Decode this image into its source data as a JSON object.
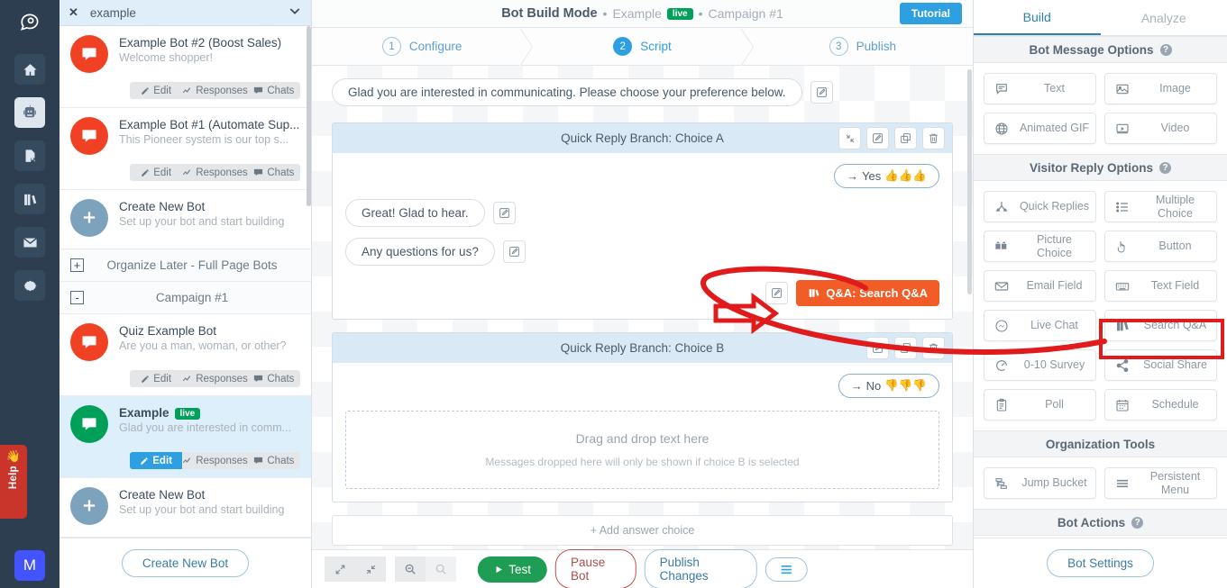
{
  "rail": {
    "logo": "speech-bubble-logo",
    "items": [
      {
        "name": "home",
        "icon": "home-icon",
        "active": false
      },
      {
        "name": "bots",
        "icon": "robot-icon",
        "active": true
      },
      {
        "name": "pages",
        "icon": "page-click-icon",
        "active": false
      },
      {
        "name": "library",
        "icon": "books-icon",
        "active": false
      },
      {
        "name": "email",
        "icon": "envelope-icon",
        "active": false
      },
      {
        "name": "settings",
        "icon": "gear-icon",
        "active": false
      }
    ],
    "help_label": "Help",
    "avatar_initial": "M"
  },
  "sidebar": {
    "search": {
      "value": "example",
      "clear_icon": "close-icon",
      "chevron_icon": "chevron-down-icon"
    },
    "action_labels": {
      "edit": "Edit",
      "responses": "Responses",
      "chats": "Chats"
    },
    "rows": [
      {
        "type": "bot",
        "name": "Example Bot #2 (Boost Sales)",
        "sub": "Welcome shopper!",
        "avatar": "red",
        "selected": false,
        "live": false,
        "edit_active": false
      },
      {
        "type": "bot",
        "name": "Example Bot #1 (Automate Sup...",
        "sub": "This Pioneer system is our top s...",
        "avatar": "red",
        "selected": false,
        "live": false,
        "edit_active": false
      },
      {
        "type": "new",
        "name": "Create New Bot",
        "sub": "Set up your bot and start building",
        "avatar": "blue"
      },
      {
        "type": "group",
        "label": "Organize Later - Full Page Bots",
        "toggle": "+"
      },
      {
        "type": "group",
        "label": "Campaign #1",
        "toggle": "-"
      },
      {
        "type": "bot",
        "name": "Quiz Example Bot",
        "sub": "Are you a man, woman, or other?",
        "avatar": "red",
        "selected": false,
        "live": false,
        "edit_active": false
      },
      {
        "type": "bot",
        "name": "Example",
        "sub": "Glad you are interested in comm...",
        "avatar": "green",
        "selected": true,
        "live": true,
        "live_label": "live",
        "edit_active": true
      },
      {
        "type": "new",
        "name": "Create New Bot",
        "sub": "Set up your bot and start building",
        "avatar": "blue"
      }
    ],
    "footer_button": "Create New Bot"
  },
  "center": {
    "title": {
      "mode": "Bot Build Mode",
      "bot_name": "Example",
      "live_label": "live",
      "campaign": "Campaign #1",
      "separator": "•"
    },
    "tutorial_button": "Tutorial",
    "steps": [
      {
        "num": "1",
        "label": "Configure",
        "active": false
      },
      {
        "num": "2",
        "label": "Script",
        "active": true
      },
      {
        "num": "3",
        "label": "Publish",
        "active": false
      }
    ],
    "intro_message": "Glad you are interested in communicating. Please choose your preference below.",
    "branch_a": {
      "title": "Quick Reply Branch: Choice A",
      "tools": [
        "collapse-icon",
        "edit-icon",
        "duplicate-icon",
        "delete-icon"
      ],
      "reply": {
        "arrow": "→",
        "label": "Yes",
        "emoji": "👍👍👍"
      },
      "messages": [
        "Great! Glad to hear.",
        "Any questions for us?"
      ],
      "qa_button": "Q&A: Search Q&A"
    },
    "branch_b": {
      "title": "Quick Reply Branch: Choice B",
      "tools": [
        "edit-icon",
        "duplicate-icon",
        "delete-icon"
      ],
      "reply": {
        "arrow": "→",
        "label": "No",
        "emoji": "👎👎👎"
      },
      "dropzone_main": "Drag and drop text here",
      "dropzone_sub": "Messages dropped here will only be shown if choice B is selected"
    },
    "add_answer_choice": "+ Add answer choice",
    "toolbar": {
      "expand_icon": "expand-icon",
      "collapse_icon": "collapse-icon",
      "zoom_in_icon": "zoom-in-icon",
      "zoom_out_icon": "zoom-out-icon",
      "test": "Test",
      "pause": "Pause Bot",
      "publish": "Publish Changes",
      "menu_icon": "hamburger-icon"
    }
  },
  "right": {
    "tabs": [
      {
        "label": "Build",
        "active": true
      },
      {
        "label": "Analyze",
        "active": false
      }
    ],
    "sections": [
      {
        "title": "Bot Message Options",
        "help": true,
        "options": [
          {
            "label": "Text",
            "icon": "text-bubble-icon"
          },
          {
            "label": "Image",
            "icon": "image-icon"
          },
          {
            "label": "Animated GIF",
            "icon": "globe-icon"
          },
          {
            "label": "Video",
            "icon": "video-icon"
          }
        ]
      },
      {
        "title": "Visitor Reply Options",
        "help": true,
        "options": [
          {
            "label": "Quick Replies",
            "icon": "branch-icon"
          },
          {
            "label": "Multiple Choice",
            "icon": "list-icon"
          },
          {
            "label": "Picture Choice",
            "icon": "picture-choice-icon"
          },
          {
            "label": "Button",
            "icon": "pointer-icon"
          },
          {
            "label": "Email Field",
            "icon": "email-icon"
          },
          {
            "label": "Text Field",
            "icon": "keyboard-icon"
          },
          {
            "label": "Live Chat",
            "icon": "messenger-icon"
          },
          {
            "label": "Search Q&A",
            "icon": "books-icon",
            "highlighted": true
          },
          {
            "label": "0-10 Survey",
            "icon": "gauge-icon"
          },
          {
            "label": "Social Share",
            "icon": "share-icon"
          },
          {
            "label": "Poll",
            "icon": "clipboard-icon"
          },
          {
            "label": "Schedule",
            "icon": "calendar-icon"
          }
        ]
      },
      {
        "title": "Organization Tools",
        "help": false,
        "options": [
          {
            "label": "Jump Bucket",
            "icon": "jump-icon"
          },
          {
            "label": "Persistent Menu",
            "icon": "menu-lines-icon"
          }
        ]
      },
      {
        "title": "Bot Actions",
        "help": true,
        "options": []
      }
    ],
    "footer_button": "Bot Settings"
  },
  "colors": {
    "rail_bg": "#2d3e50",
    "accent_blue": "#2e9fe0",
    "live_green": "#00a05a",
    "bot_red": "#f04124",
    "qa_orange": "#f25c26",
    "highlight_red": "#e01b1b",
    "test_green": "#1f9d55"
  }
}
